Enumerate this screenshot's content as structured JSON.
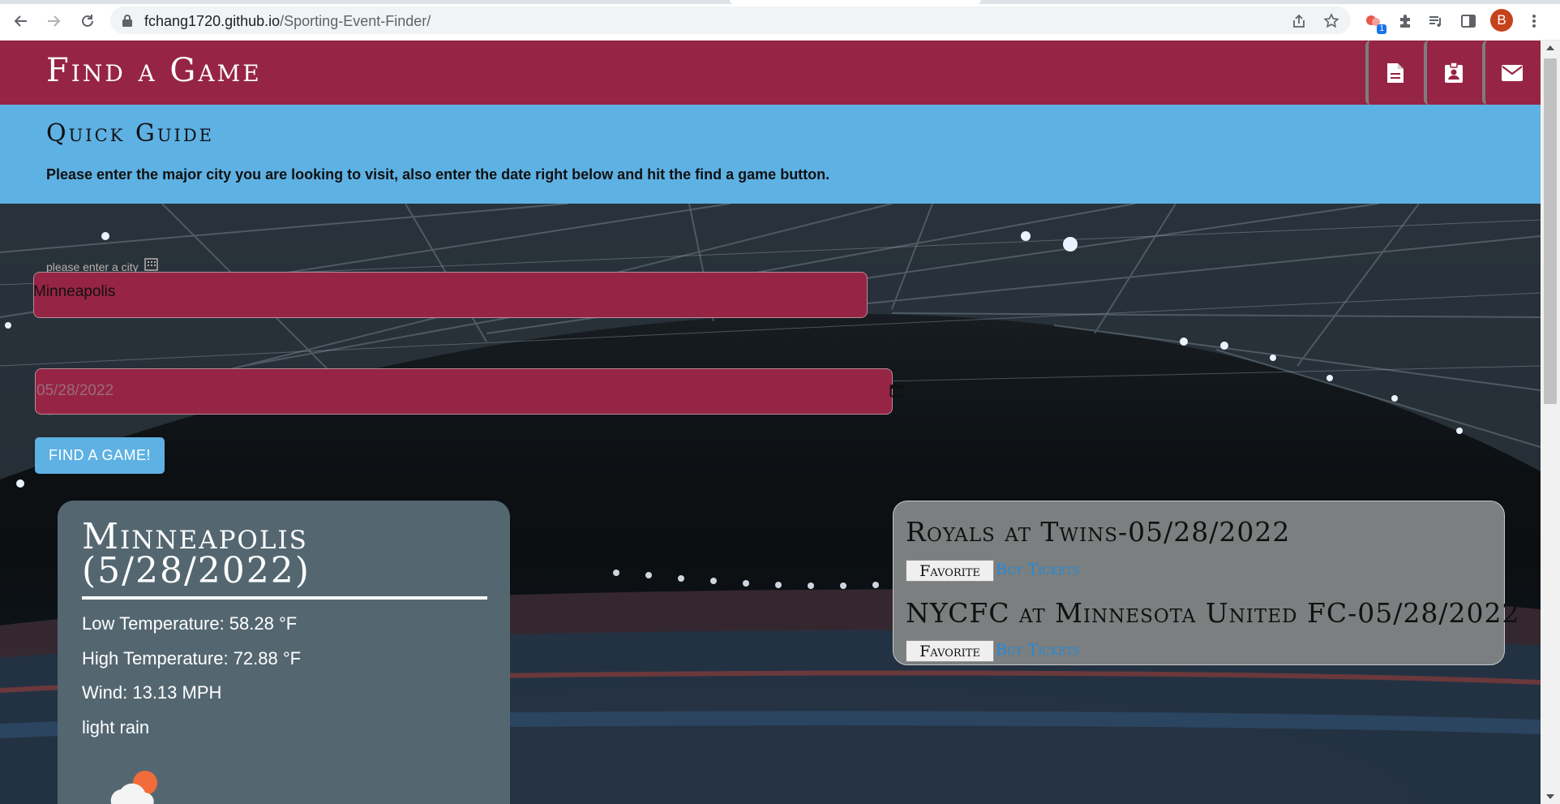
{
  "browser": {
    "url_host": "fchang1720.github.io",
    "url_path": "/Sporting-Event-Finder/",
    "extension_badge": "1",
    "profile_initial": "B"
  },
  "header": {
    "title": "Find a Game",
    "icons": [
      "document-icon",
      "contact-card-icon",
      "mail-icon"
    ]
  },
  "guide": {
    "title": "Quick Guide",
    "text": "Please enter the major city you are looking to visit, also enter the date right below and hit the find a game button."
  },
  "form": {
    "city_label": "please enter a city",
    "city_value": "Minneapolis",
    "date_value": "05/28/2022",
    "submit_label": "FIND A GAME!"
  },
  "weather": {
    "title": "Minneapolis (5/28/2022)",
    "low": "Low Temperature: 58.28 °F",
    "high": "High Temperature: 72.88 °F",
    "wind": "Wind: 13.13 MPH",
    "description": "light rain",
    "icon": "cloud-rain-sun-icon"
  },
  "games": [
    {
      "title": "Royals at Twins-05/28/2022",
      "favorite_label": "Favorite",
      "tickets_label": "Buy Tickets"
    },
    {
      "title": "NYCFC at Minnesota United FC-05/28/2022",
      "favorite_label": "Favorite",
      "tickets_label": "Buy Tickets"
    }
  ],
  "colors": {
    "maroon": "#962445",
    "sky": "#5eb1e3",
    "weather_card": "#546771",
    "games_card": "#7b7f7f",
    "link": "#1f8ae0"
  }
}
